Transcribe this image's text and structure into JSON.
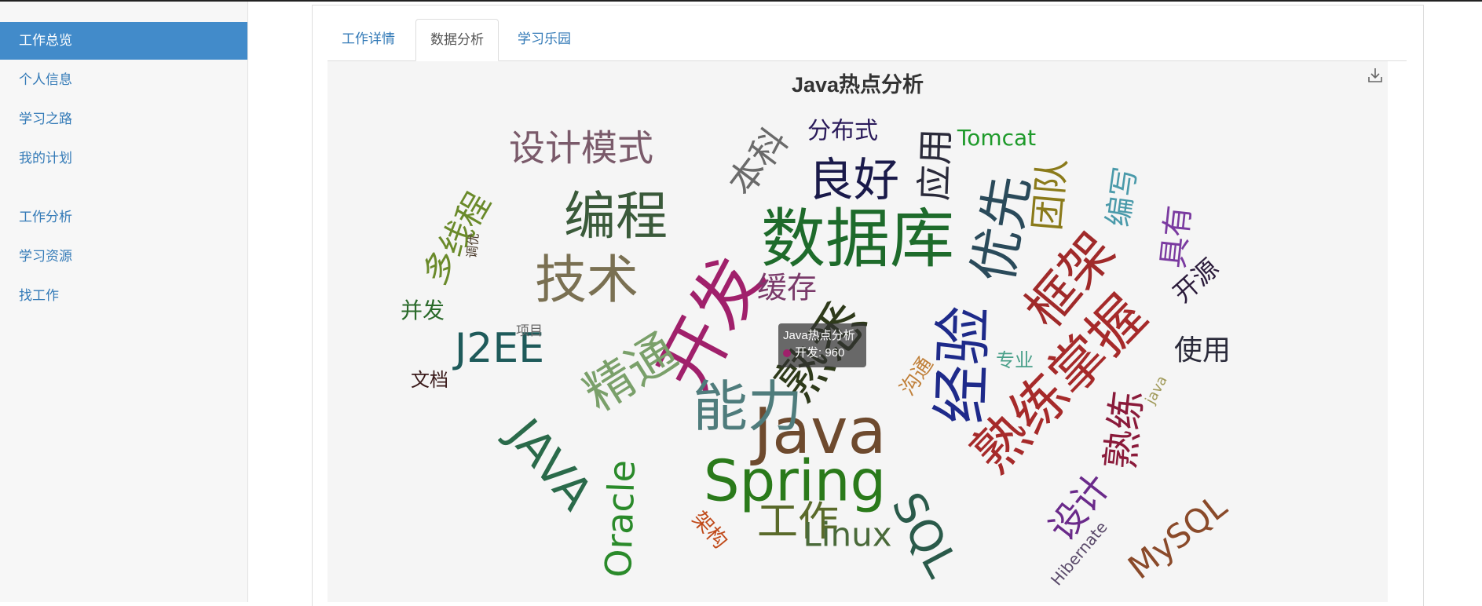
{
  "sidebar": {
    "items": [
      {
        "label": "工作总览",
        "active": true
      },
      {
        "label": "个人信息"
      },
      {
        "label": "学习之路"
      },
      {
        "label": "我的计划"
      },
      {
        "label": "工作分析"
      },
      {
        "label": "学习资源"
      },
      {
        "label": "找工作"
      }
    ]
  },
  "tabs": [
    {
      "label": "工作详情"
    },
    {
      "label": "数据分析",
      "active": true
    },
    {
      "label": "学习乐园"
    }
  ],
  "chart": {
    "title": "Java热点分析",
    "download_icon": "download-icon"
  },
  "tooltip": {
    "series": "Java热点分析",
    "text": "开发: 960",
    "color": "#a0206b"
  },
  "chart_data": {
    "type": "wordcloud",
    "title": "Java热点分析",
    "words": [
      {
        "text": "开发",
        "value": 960,
        "color": "#a0206b"
      },
      {
        "text": "数据库",
        "color": "#1e6b2b"
      },
      {
        "text": "Java",
        "color": "#6e4a2e"
      },
      {
        "text": "Spring",
        "color": "#2a7a1a"
      },
      {
        "text": "熟练掌握",
        "color": "#a62a2a"
      },
      {
        "text": "经验",
        "color": "#1e2a8a"
      },
      {
        "text": "熟悉",
        "color": "#2e3a1a"
      },
      {
        "text": "技术",
        "color": "#7a7052"
      },
      {
        "text": "能力",
        "color": "#4f7c7c"
      },
      {
        "text": "精通",
        "color": "#7aa06a"
      },
      {
        "text": "编程",
        "color": "#3a5a3a"
      },
      {
        "text": "优先",
        "color": "#2a4a5a"
      },
      {
        "text": "框架",
        "color": "#a02a2a"
      },
      {
        "text": "良好",
        "color": "#1a1a4a"
      },
      {
        "text": "JAVA",
        "color": "#2a6a4a"
      },
      {
        "text": "J2EE",
        "color": "#1e5a5a"
      },
      {
        "text": "设计模式",
        "color": "#7a5a6a"
      },
      {
        "text": "多线程",
        "color": "#6a8a2a"
      },
      {
        "text": "SQL",
        "color": "#2a5a4a"
      },
      {
        "text": "熟练",
        "color": "#8a1a3a"
      },
      {
        "text": "设计",
        "color": "#6a2a8a"
      },
      {
        "text": "团队",
        "color": "#8a7a1a"
      },
      {
        "text": "工作",
        "color": "#5a6a2a"
      },
      {
        "text": "Oracle",
        "color": "#2a8a2a"
      },
      {
        "text": "Linux",
        "color": "#4a6a3a"
      },
      {
        "text": "MySQL",
        "color": "#8a4a2a"
      },
      {
        "text": "本科",
        "color": "#6a6a6a"
      },
      {
        "text": "应用",
        "color": "#2a2a3a"
      },
      {
        "text": "具有",
        "color": "#7a3aa0"
      },
      {
        "text": "编写",
        "color": "#4a9aaa"
      },
      {
        "text": "缓存",
        "color": "#7a3a6a"
      },
      {
        "text": "分布式",
        "color": "#2a1a5a"
      },
      {
        "text": "Tomcat",
        "color": "#1e9a2a"
      },
      {
        "text": "开源",
        "color": "#2a1a3a"
      },
      {
        "text": "使用",
        "color": "#2a2a3a"
      },
      {
        "text": "并发",
        "color": "#2a6a2a"
      },
      {
        "text": "文档",
        "color": "#3a1a1a"
      },
      {
        "text": "项目",
        "color": "#6a6a6a"
      },
      {
        "text": "调优",
        "color": "#4a3a2a"
      },
      {
        "text": "沟通",
        "color": "#c0803a"
      },
      {
        "text": "专业",
        "color": "#4aa08a"
      },
      {
        "text": "java",
        "color": "#a09a5a"
      },
      {
        "text": "架构",
        "color": "#c04a1a"
      },
      {
        "text": "Hibernate",
        "color": "#5a4a6a"
      }
    ]
  }
}
